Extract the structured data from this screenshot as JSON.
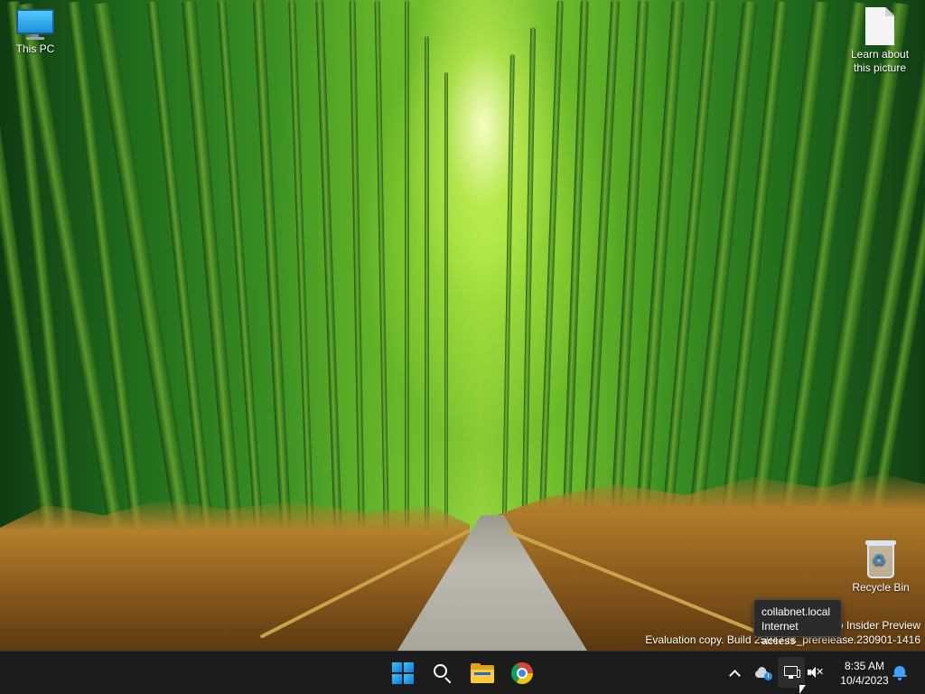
{
  "desktop": {
    "icons": [
      {
        "label": "This PC",
        "icon": "monitor-icon"
      },
      {
        "label": "Learn about this picture",
        "icon": "document-icon"
      },
      {
        "label": "Recycle Bin",
        "icon": "recycle-bin-icon"
      }
    ],
    "watermark": {
      "line1": "o Insider Preview",
      "line2": "Evaluation copy. Build 25947.rs_prerelease.230901-1416"
    }
  },
  "tooltip": {
    "line1": "collabnet.local",
    "line2": "Internet access"
  },
  "taskbar": {
    "pinned": [
      {
        "name": "Start",
        "icon": "windows-start-icon"
      },
      {
        "name": "Search",
        "icon": "search-icon"
      },
      {
        "name": "File Explorer",
        "icon": "folder-icon"
      },
      {
        "name": "Google Chrome",
        "icon": "chrome-icon"
      }
    ],
    "tray": {
      "overflow_icon": "chevron-up-icon",
      "onedrive_icon": "onedrive-cloud-icon",
      "network_icon": "network-wired-icon",
      "volume_icon": "speaker-muted-icon",
      "time": "8:35 AM",
      "date": "10/4/2023",
      "notifications_icon": "bell-icon"
    }
  },
  "colors": {
    "taskbar_bg": "#1c1c1c",
    "accent": "#3fa0ff"
  }
}
